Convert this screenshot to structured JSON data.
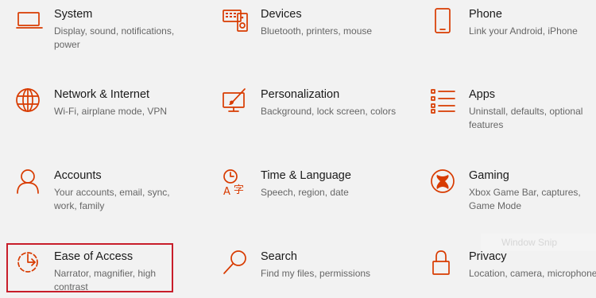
{
  "accent_color": "#d83b01",
  "highlight_color": "#c81e2a",
  "tiles": [
    {
      "title": "System",
      "desc": "Display, sound, notifications, power",
      "icon": "laptop-icon"
    },
    {
      "title": "Devices",
      "desc": "Bluetooth, printers, mouse",
      "icon": "devices-icon"
    },
    {
      "title": "Phone",
      "desc": "Link your Android, iPhone",
      "icon": "phone-icon"
    },
    {
      "title": "Network & Internet",
      "desc": "Wi-Fi, airplane mode, VPN",
      "icon": "globe-icon"
    },
    {
      "title": "Personalization",
      "desc": "Background, lock screen, colors",
      "icon": "personalization-icon"
    },
    {
      "title": "Apps",
      "desc": "Uninstall, defaults, optional features",
      "icon": "apps-list-icon"
    },
    {
      "title": "Accounts",
      "desc": "Your accounts, email, sync, work, family",
      "icon": "person-icon"
    },
    {
      "title": "Time & Language",
      "desc": "Speech, region, date",
      "icon": "time-language-icon"
    },
    {
      "title": "Gaming",
      "desc": "Xbox Game Bar, captures, Game Mode",
      "icon": "xbox-icon"
    },
    {
      "title": "Ease of Access",
      "desc": "Narrator, magnifier, high contrast",
      "icon": "ease-of-access-icon"
    },
    {
      "title": "Search",
      "desc": "Find my files, permissions",
      "icon": "search-icon"
    },
    {
      "title": "Privacy",
      "desc": "Location, camera, microphone",
      "icon": "lock-icon"
    }
  ],
  "watermark": "Window Snip"
}
